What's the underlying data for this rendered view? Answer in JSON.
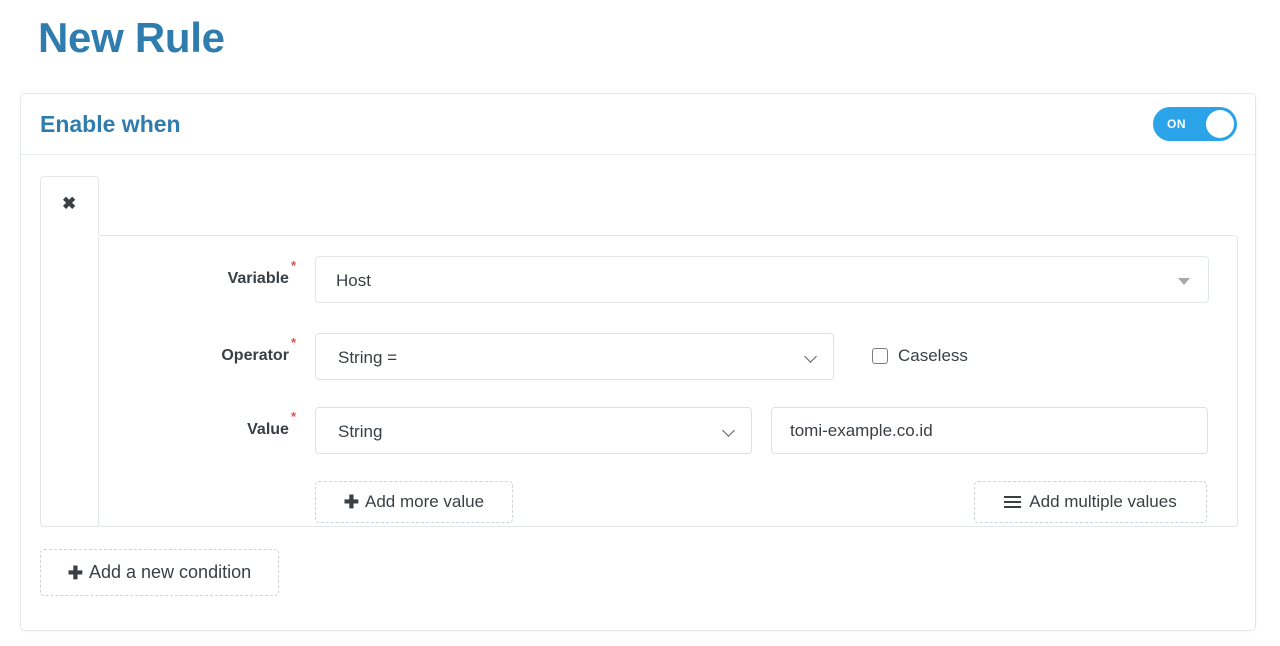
{
  "page": {
    "title": "New Rule"
  },
  "panel": {
    "header_title": "Enable when",
    "toggle": {
      "label": "ON",
      "state": "on",
      "color": "#2aa3e8"
    }
  },
  "condition": {
    "close_label": "✖",
    "fields": {
      "variable": {
        "label": "Variable",
        "required_marker": "*",
        "value": "Host"
      },
      "operator": {
        "label": "Operator",
        "required_marker": "*",
        "value": "String =",
        "caseless": {
          "label": "Caseless",
          "checked": false
        }
      },
      "value": {
        "label": "Value",
        "required_marker": "*",
        "type_value": "String",
        "text_value": "tomi-example.co.id",
        "text_placeholder": ""
      }
    },
    "actions": {
      "add_more_value": "Add more value",
      "add_multiple_values": "Add multiple values"
    }
  },
  "footer": {
    "add_new_condition": "Add a new condition"
  },
  "theme": {
    "accent_blue": "#2f7cae",
    "toggle_blue": "#2aa3e8",
    "required_red": "#d9534f",
    "border_gray": "#e4e7ea"
  }
}
